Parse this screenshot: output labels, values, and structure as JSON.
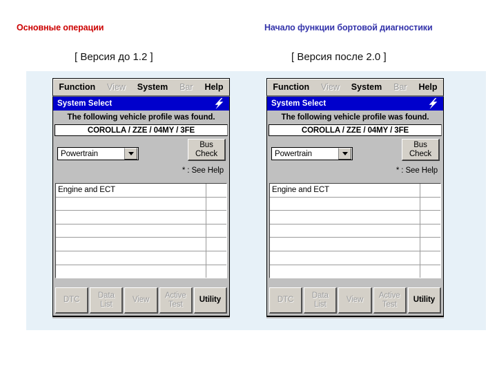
{
  "headings": {
    "left": "Основные операции",
    "right": "Начало функции бортовой диагностики",
    "left_color": "#cc0000",
    "right_color": "#3333aa"
  },
  "versions": {
    "left": "[ Версия до 1.2 ]",
    "right": "[ Версия после 2.0 ]"
  },
  "device": {
    "menu": [
      {
        "label": "Function",
        "disabled": false
      },
      {
        "label": "View",
        "disabled": true
      },
      {
        "label": "System",
        "disabled": false
      },
      {
        "label": "Bar",
        "disabled": true
      },
      {
        "label": "Help",
        "disabled": false
      }
    ],
    "titlebar": {
      "title": "System Select",
      "icon": "lightning-bolt-icon",
      "bg_color": "#0000cc"
    },
    "profile_message": "The following vehicle profile was found.",
    "vehicle_profile": "COROLLA / ZZE / 04MY / 3FE",
    "system_select": {
      "value": "Powertrain",
      "arrow_icon": "chevron-down-icon"
    },
    "bus_check": {
      "line1": "Bus",
      "line2": "Check"
    },
    "see_help_note": "* : See Help",
    "list_rows": [
      "Engine and ECT",
      "",
      "",
      "",
      "",
      "",
      ""
    ],
    "buttons": [
      {
        "line1": "DTC",
        "line2": "",
        "disabled": true
      },
      {
        "line1": "Data",
        "line2": "List",
        "disabled": true
      },
      {
        "line1": "View",
        "line2": "",
        "disabled": true
      },
      {
        "line1": "Active",
        "line2": "Test",
        "disabled": true
      },
      {
        "line1": "Utility",
        "line2": "",
        "disabled": false
      }
    ]
  }
}
